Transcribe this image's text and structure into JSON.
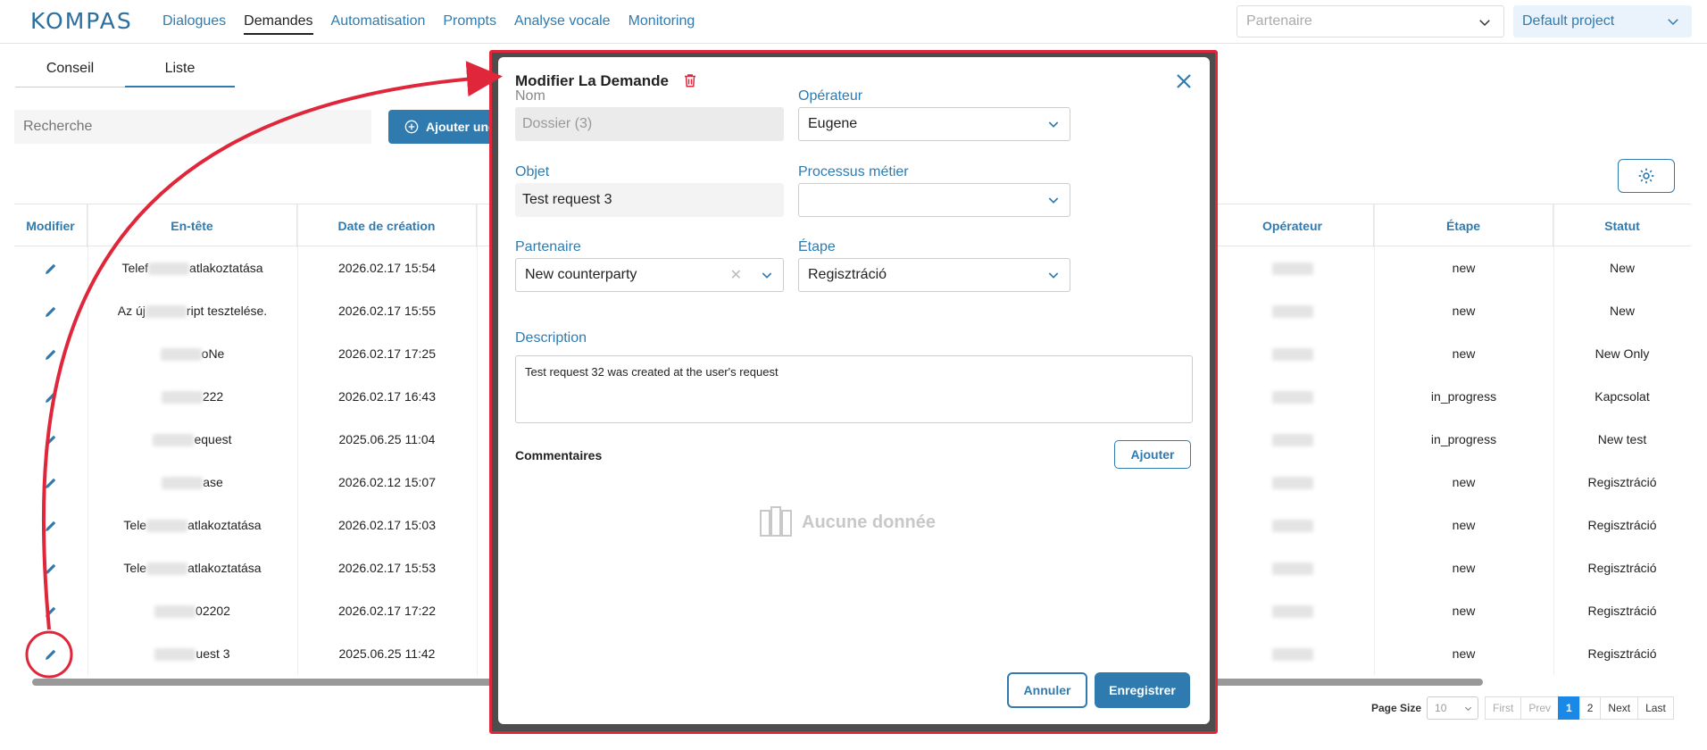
{
  "header": {
    "logo": "KOMPAS",
    "nav": [
      "Dialogues",
      "Demandes",
      "Automatisation",
      "Prompts",
      "Analyse vocale",
      "Monitoring"
    ],
    "active_nav": "Demandes",
    "partner_placeholder": "Partenaire",
    "project": "Default project"
  },
  "tabs": [
    "Conseil",
    "Liste"
  ],
  "active_tab": "Liste",
  "search_placeholder": "Recherche",
  "add_button_label": "Ajouter une",
  "table": {
    "left_headers": [
      "Modifier",
      "En-tête",
      "Date de création"
    ],
    "right_headers": [
      "Opérateur",
      "Étape",
      "Statut"
    ],
    "rows": [
      {
        "entete_pre": "Telef",
        "entete_post": "atlakoztatása",
        "date": "2026.02.17 15:54",
        "etape": "new",
        "statut": "New"
      },
      {
        "entete_pre": "Az új",
        "entete_post": "ript tesztelése.",
        "date": "2026.02.17 15:55",
        "etape": "new",
        "statut": "New"
      },
      {
        "entete_pre": "",
        "entete_post": "oNe",
        "date": "2026.02.17 17:25",
        "etape": "new",
        "statut": "New Only"
      },
      {
        "entete_pre": "",
        "entete_post": "222",
        "date": "2026.02.17 16:43",
        "etape": "in_progress",
        "statut": "Kapcsolat"
      },
      {
        "entete_pre": "",
        "entete_post": "equest",
        "date": "2025.06.25 11:04",
        "etape": "in_progress",
        "statut": "New test"
      },
      {
        "entete_pre": "",
        "entete_post": "ase",
        "date": "2026.02.12 15:07",
        "etape": "new",
        "statut": "Regisztráció"
      },
      {
        "entete_pre": "Tele",
        "entete_post": "atlakoztatása",
        "date": "2026.02.17 15:03",
        "etape": "new",
        "statut": "Regisztráció"
      },
      {
        "entete_pre": "Tele",
        "entete_post": "atlakoztatása",
        "date": "2026.02.17 15:53",
        "etape": "new",
        "statut": "Regisztráció"
      },
      {
        "entete_pre": "",
        "entete_post": "02202",
        "date": "2026.02.17 17:22",
        "etape": "new",
        "statut": "Regisztráció"
      },
      {
        "entete_pre": "",
        "entete_post": "uest 3",
        "date": "2025.06.25 11:42",
        "etape": "new",
        "statut": "Regisztráció"
      }
    ]
  },
  "pagination": {
    "page_size_label": "Page Size",
    "page_size": "10",
    "buttons": [
      "First",
      "Prev",
      "1",
      "2",
      "Next",
      "Last"
    ],
    "current": "1"
  },
  "modal": {
    "title": "Modifier La Demande",
    "nom_label": "Nom",
    "nom_value": "Dossier (3)",
    "operateur_label": "Opérateur",
    "operateur_value": "Eugene",
    "objet_label": "Objet",
    "objet_value": "Test request 3",
    "processus_label": "Processus métier",
    "processus_value": "",
    "partenaire_label": "Partenaire",
    "partenaire_value": "New counterparty",
    "etape_label": "Étape",
    "etape_value": "Regisztráció",
    "description_label": "Description",
    "description_value": "Test request 32 was created at the user's request",
    "commentaires_label": "Commentaires",
    "ajouter_label": "Ajouter",
    "no_data": "Aucune donnée",
    "cancel_label": "Annuler",
    "save_label": "Enregistrer"
  },
  "colors": {
    "accent": "#2f7bb0",
    "annotation": "#e0263a"
  }
}
